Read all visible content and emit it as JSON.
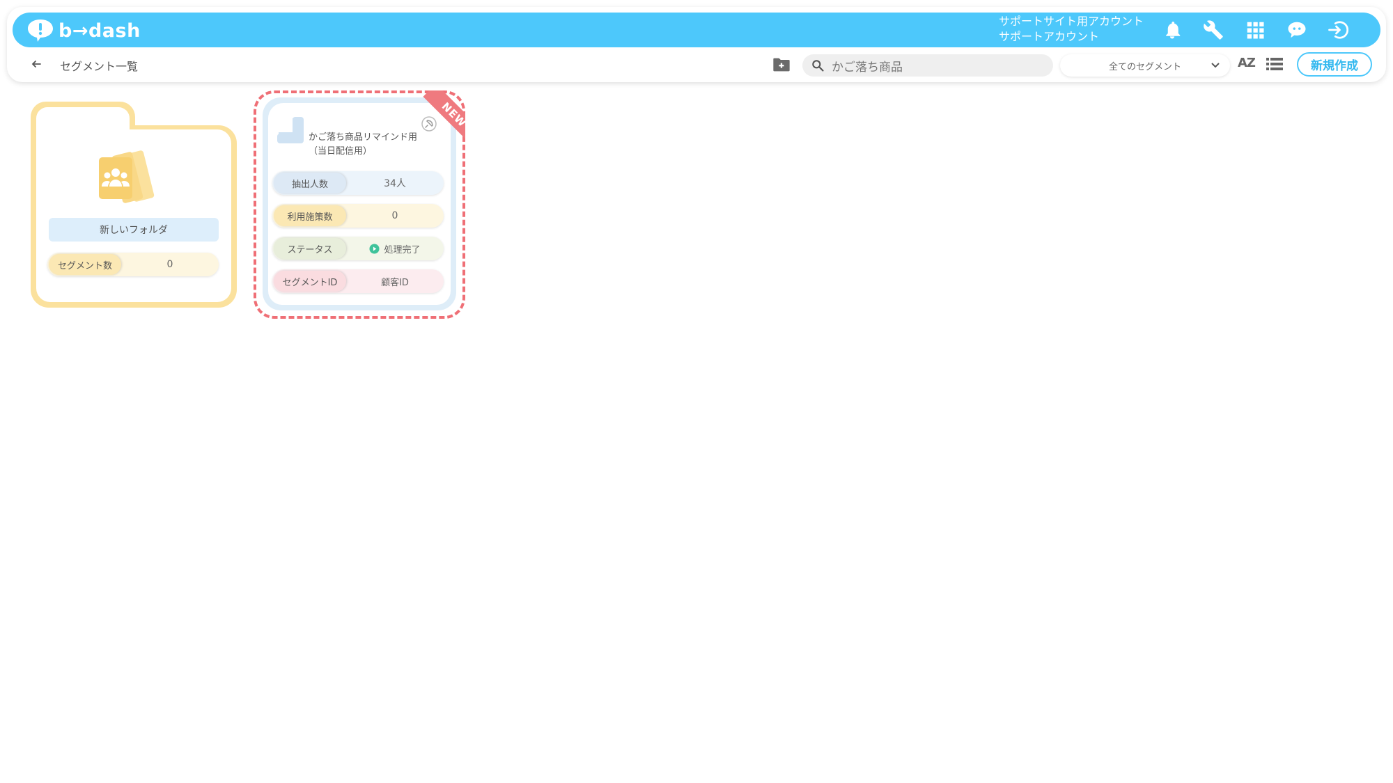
{
  "header": {
    "logo_text": "b→dash",
    "account_line1": "サポートサイト用アカウント",
    "account_line2": "サポートアカウント",
    "icons": [
      "bell-icon",
      "wrench-icon",
      "apps-grid-icon",
      "chat-bot-icon",
      "logout-icon"
    ]
  },
  "toolbar": {
    "title": "セグメント一覧",
    "search_value": "かご落ち商品",
    "filter_selected": "全てのセグメント",
    "sort_label": "AZ",
    "new_button": "新規作成"
  },
  "folder": {
    "name": "新しいフォルダ",
    "count_label": "セグメント数",
    "count_value": "0"
  },
  "segment": {
    "badge": "NEW",
    "title_line1": "かご落ち商品リマインド用",
    "title_line2": "（当日配信用）",
    "rows": [
      {
        "label": "抽出人数",
        "value": "34人"
      },
      {
        "label": "利用施策数",
        "value": "0"
      },
      {
        "label": "ステータス",
        "value": "処理完了"
      },
      {
        "label": "セグメントID",
        "value": "顧客ID"
      }
    ]
  },
  "colors": {
    "brand": "#4dc8fb",
    "folder": "#fbe19d",
    "highlight": "#ef6f76",
    "status_ok": "#3fc39a"
  }
}
